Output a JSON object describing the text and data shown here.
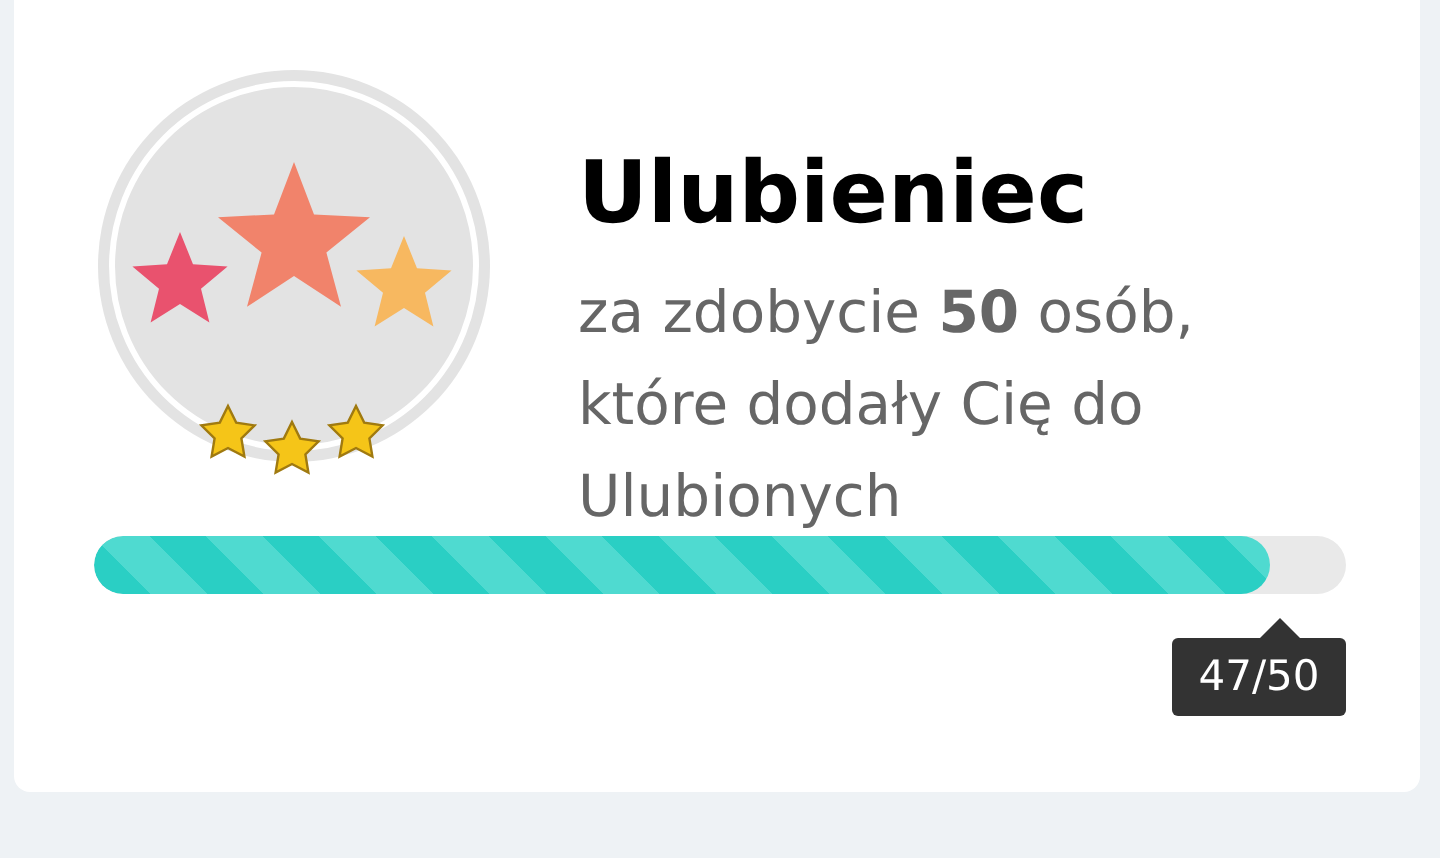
{
  "achievement": {
    "title": "Ulubieniec",
    "description": "za zdobycie **50** osób, które dodały Cię do Ulubionych",
    "stars": 3
  },
  "progress": {
    "level": 0.94,
    "label": "47/50"
  }
}
